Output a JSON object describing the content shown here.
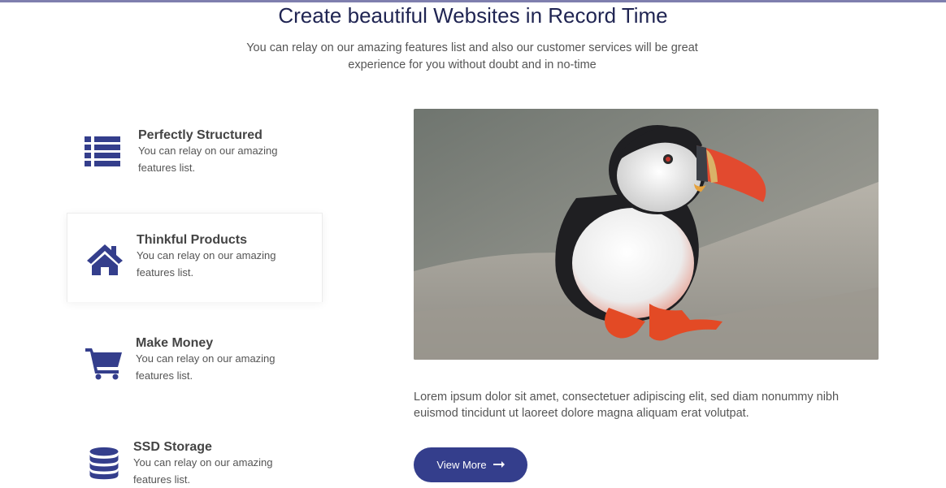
{
  "header": {
    "title": "Create beautiful Websites in Record Time",
    "subtitle": "You can relay on our amazing features list and also our customer services will be great experience for you without doubt and in no-time"
  },
  "features": [
    {
      "title": "Perfectly Structured",
      "description": "You can relay on our amazing features list.",
      "icon": "list-icon"
    },
    {
      "title": "Thinkful Products",
      "description": "You can relay on our amazing features list.",
      "icon": "home-icon",
      "active": true
    },
    {
      "title": "Make Money",
      "description": "You can relay on our amazing features list.",
      "icon": "shopping-cart-icon"
    },
    {
      "title": "SSD Storage",
      "description": "You can relay on our amazing features list.",
      "icon": "database-icon"
    }
  ],
  "content": {
    "image": "puffin-photo",
    "paragraph": "Lorem ipsum dolor sit amet, consectetuer adipiscing elit, sed diam nonummy nibh euismod tincidunt ut laoreet dolore magna aliquam erat volutpat.",
    "button_label": "View More",
    "button_icon": "long-arrow-right-icon"
  },
  "colors": {
    "accent": "#343e8c",
    "heading": "#1f2452",
    "text": "#555555"
  }
}
